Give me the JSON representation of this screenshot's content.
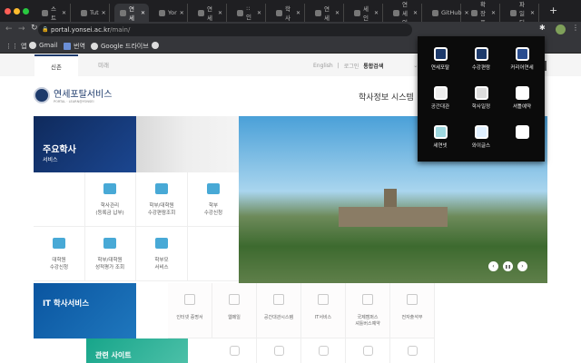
{
  "browser": {
    "tabs": [
      {
        "label": "스트"
      },
      {
        "label": "Tut"
      },
      {
        "label": "연세"
      },
      {
        "label": "Yor"
      },
      {
        "label": "연세"
      },
      {
        "label": ":: 인"
      },
      {
        "label": "학사"
      },
      {
        "label": "연세"
      },
      {
        "label": "세인"
      },
      {
        "label": "연세인"
      },
      {
        "label": "GitHub"
      },
      {
        "label": "확장 프"
      },
      {
        "label": "파일 디"
      }
    ],
    "new_tab": "+",
    "url_host": "portal.yonsei.ac.kr",
    "url_path": "/main/",
    "bookmarks": [
      {
        "label": "앱"
      },
      {
        "label": "Gmail"
      },
      {
        "label": "번역"
      },
      {
        "label": "Google 드라이브"
      }
    ],
    "colors": {
      "tabbar": "#1f1f22",
      "toolbar": "#35363a"
    }
  },
  "popup": {
    "apps": [
      {
        "label": "연세포탈"
      },
      {
        "label": "수강편람"
      },
      {
        "label": "커리어연세"
      },
      {
        "label": "공간대관"
      },
      {
        "label": "학사일정"
      },
      {
        "label": "셔틀예약"
      },
      {
        "label": "세연넷"
      },
      {
        "label": "와이글스"
      },
      {
        "label": ""
      }
    ]
  },
  "subnav": {
    "tabs": [
      {
        "label": "신촌"
      },
      {
        "label": "미래"
      }
    ],
    "english": "English",
    "sep": "|",
    "login": "로그인",
    "search_select": "통합검색",
    "search_button": "검색"
  },
  "header": {
    "logo_title": "연세포탈서비스",
    "logo_sub": "PORTAL · LEARN@YONSEI",
    "system_title": "학사정보 시스템"
  },
  "main_services": {
    "title": "주요학사",
    "subtitle": "서비스",
    "items": [
      {
        "label": "학사관리\n(등록금 납부)"
      },
      {
        "label": "학부/대학원\n수강편람조회"
      },
      {
        "label": "학부\n수강신청"
      },
      {
        "label": "대학원\n수강신청"
      },
      {
        "label": "학부/대학원\n성적평가 조회"
      },
      {
        "label": "학부모\n서비스"
      }
    ]
  },
  "hero": {
    "prev": "‹",
    "pause": "❚❚",
    "next": "›"
  },
  "it_services": {
    "title": "IT 학사서비스",
    "items": [
      {
        "label": "인터넷 증명서"
      },
      {
        "label": "웹메일"
      },
      {
        "label": "공간대관시스템"
      },
      {
        "label": "IT서비스"
      },
      {
        "label": "국제캠퍼스\n셔틀버스예약"
      },
      {
        "label": "전자출석부"
      }
    ]
  },
  "related": {
    "title": "관련 사이트"
  }
}
